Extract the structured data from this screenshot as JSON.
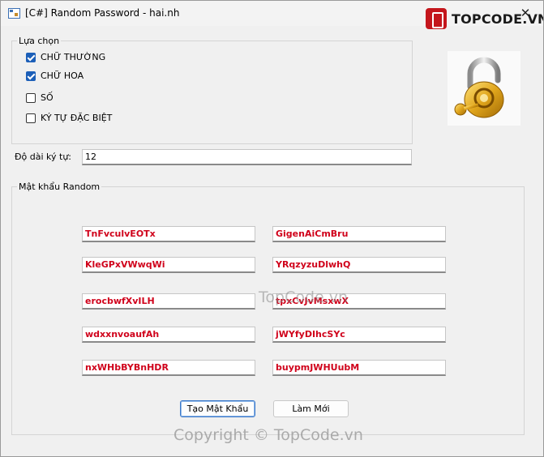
{
  "window": {
    "title": "[C#] Random Password - hai.nh"
  },
  "brand": {
    "text": "TOPCODE.VN"
  },
  "options": {
    "legend": "Lựa chọn",
    "items": [
      {
        "label": "CHỮ THƯỜNG",
        "checked": true
      },
      {
        "label": "CHỮ HOA",
        "checked": true
      },
      {
        "label": "SỐ",
        "checked": false
      },
      {
        "label": "KÝ TỰ ĐẶC BIỆT",
        "checked": false
      }
    ]
  },
  "length": {
    "label": "Độ dài ký tự:",
    "value": "12"
  },
  "passwords": {
    "legend": "Mật khẩu Random",
    "left": [
      "TnFvculvEOTx",
      "KleGPxVWwqWi",
      "erocbwfXvILH",
      "wdxxnvoaufAh",
      "nxWHbBYBnHDR"
    ],
    "right": [
      "GigenAiCmBru",
      "YRqzyzuDlwhQ",
      "tpxCvJvMsxwX",
      "jWYfyDIhcSYc",
      "buypmJWHUubM"
    ]
  },
  "buttons": {
    "generate": "Tạo Mật Khẩu",
    "reset": "Làm Mới"
  },
  "watermarks": {
    "center": "TopCode.vn",
    "bottom": "Copyright © TopCode.vn"
  },
  "colors": {
    "password_text": "#d0021b",
    "checkbox_checked": "#1c5fb8",
    "brand_red": "#c4161c"
  }
}
